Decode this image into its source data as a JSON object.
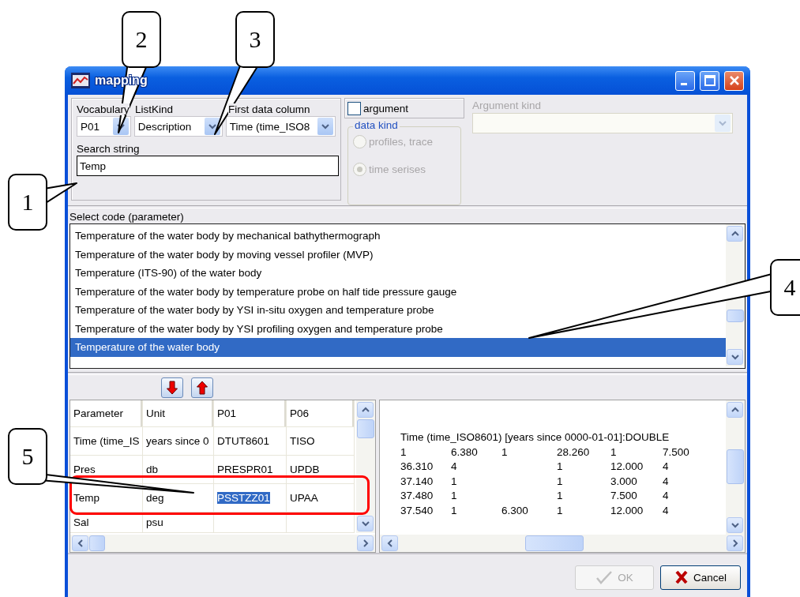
{
  "window": {
    "title": "mapping"
  },
  "vocabulary": {
    "label": "Vocabulary",
    "value": "P01"
  },
  "list_kind": {
    "label": "ListKind",
    "value": "Description"
  },
  "first_data_column": {
    "label": "First data column",
    "value": "Time (time_ISO8"
  },
  "search": {
    "label": "Search string",
    "value": "Temp"
  },
  "argument": {
    "label": "argument",
    "checked": false
  },
  "data_kind": {
    "label": "data kind",
    "disabled": true,
    "options": [
      {
        "label": "profiles, trace",
        "selected": false
      },
      {
        "label": "time serises",
        "selected": true
      }
    ]
  },
  "argument_kind": {
    "label": "Argument kind",
    "disabled": true
  },
  "code_list": {
    "label": "Select code (parameter)",
    "items": [
      {
        "label": "Temperature of the water body by mechanical bathythermograph",
        "selected": false
      },
      {
        "label": "Temperature of the water body by moving vessel profiler (MVP)",
        "selected": false
      },
      {
        "label": "Temperature (ITS-90) of the water body",
        "selected": false
      },
      {
        "label": "Temperature of the water body by temperature probe on half tide pressure gauge",
        "selected": false
      },
      {
        "label": "Temperature of the water body by YSI in-situ oxygen and temperature probe",
        "selected": false
      },
      {
        "label": "Temperature of the water body by YSI profiling oxygen and temperature probe",
        "selected": false
      },
      {
        "label": "Temperature of the water body",
        "selected": true
      }
    ]
  },
  "grid": {
    "columns": [
      "Parameter",
      "Unit",
      "P01",
      "P06"
    ],
    "rows": [
      {
        "cells": [
          {
            "text": "Time (time_IS",
            "selected": false
          },
          {
            "text": "years since 0",
            "selected": false
          },
          {
            "text": "DTUT8601",
            "selected": false
          },
          {
            "text": "TISO",
            "selected": false
          }
        ]
      },
      {
        "cells": [
          {
            "text": "Pres",
            "selected": false
          },
          {
            "text": "db",
            "selected": false
          },
          {
            "text": "PRESPR01",
            "selected": false
          },
          {
            "text": "UPDB",
            "selected": false
          }
        ]
      },
      {
        "cells": [
          {
            "text": "Temp",
            "selected": false
          },
          {
            "text": "deg",
            "selected": false
          },
          {
            "text": "PSSTZZ01",
            "selected": true
          },
          {
            "text": "UPAA",
            "selected": false
          }
        ]
      },
      {
        "cells": [
          {
            "text": "Sal",
            "selected": false
          },
          {
            "text": "psu",
            "selected": false
          }
        ]
      }
    ]
  },
  "preview": {
    "header": "Time (time_ISO8601) [years since 0000-01-01]:DOUBLE",
    "rows": [
      [
        "1",
        "6.380",
        "1",
        "28.260",
        "1",
        "7.500"
      ],
      [
        "36.310",
        "4",
        null,
        "1",
        "12.000",
        "4"
      ],
      [
        "37.140",
        "1",
        null,
        "1",
        "3.000",
        "4"
      ],
      [
        "37.480",
        "1",
        null,
        "1",
        "7.500",
        "4"
      ],
      [
        "37.540",
        "1",
        "6.300",
        "1",
        "12.000",
        "4"
      ]
    ]
  },
  "buttons": [
    {
      "kind": "ok",
      "label": "OK",
      "disabled": true
    },
    {
      "kind": "cancel",
      "label": "Cancel",
      "disabled": false
    }
  ],
  "callouts": [
    {
      "label": "1"
    },
    {
      "label": "2"
    },
    {
      "label": "3"
    },
    {
      "label": "4"
    },
    {
      "label": "5"
    }
  ]
}
